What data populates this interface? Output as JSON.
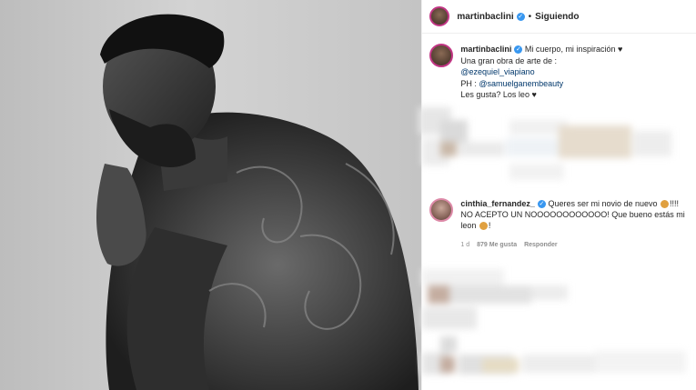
{
  "post": {
    "username": "martinbaclini",
    "verified_mark": "✓",
    "separator": "•",
    "follow_status": "Siguiendo"
  },
  "caption": {
    "username": "martinbaclini",
    "line1": "Mi cuerpo, mi inspiración ♥",
    "line2": "Una gran obra de arte de :",
    "mention1": "@ezequiel_viapiano",
    "ph_prefix": "PH : ",
    "mention2": "@samuelganembeauty",
    "line5": "Les gusta? Los leo ♥"
  },
  "comment": {
    "username": "cinthia_fernandez_",
    "text_a": "Queres ser mi novio de nuevo",
    "text_b": "!!!! NO ACEPTO UN NOOOOOOOOOOOO! Que bueno estás mi leon",
    "text_c": "!",
    "time": "1 d",
    "likes": "879 Me gusta",
    "reply": "Responder"
  },
  "colors": {
    "verified_blue": "#3897f0",
    "mention_blue": "#00376b",
    "story_ring": "#c13584"
  }
}
